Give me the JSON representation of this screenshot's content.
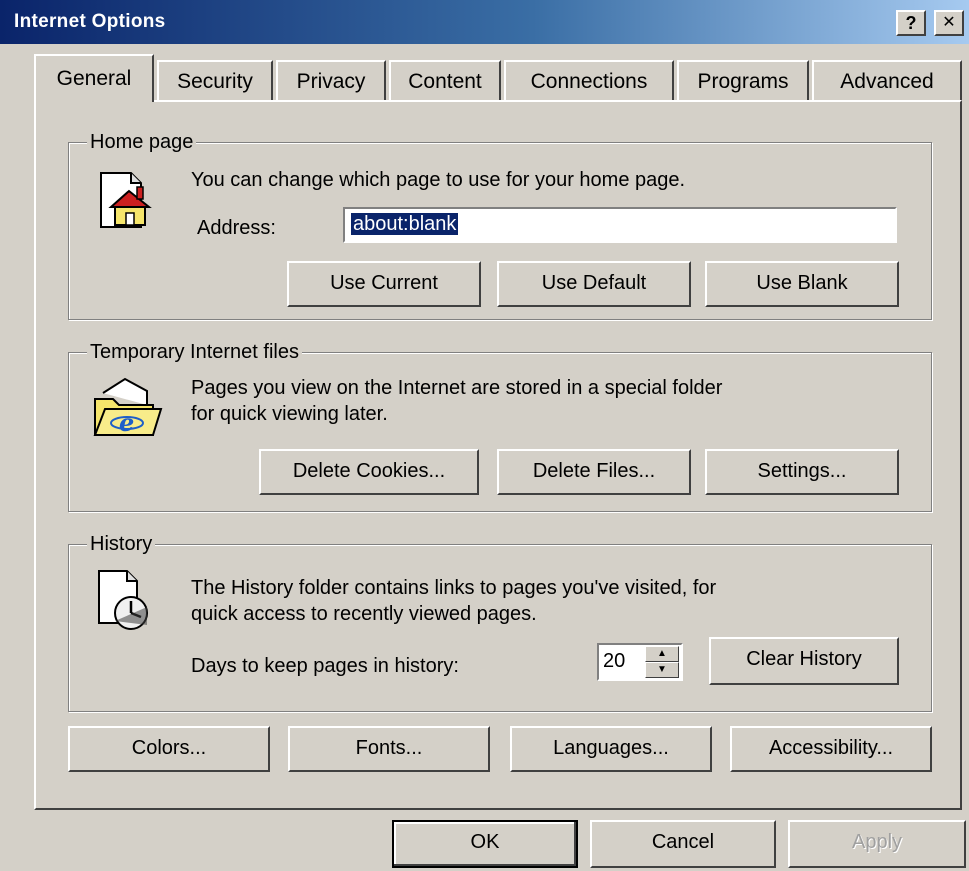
{
  "window": {
    "title": "Internet Options",
    "help_label": "?",
    "close_label": "✕"
  },
  "tabs": [
    {
      "label": "General",
      "active": true
    },
    {
      "label": "Security"
    },
    {
      "label": "Privacy"
    },
    {
      "label": "Content"
    },
    {
      "label": "Connections"
    },
    {
      "label": "Programs"
    },
    {
      "label": "Advanced"
    }
  ],
  "home_page": {
    "legend": "Home page",
    "description": "You can change which page to use for your home page.",
    "address_label": "Address:",
    "address_value": "about:blank",
    "use_current": "Use Current",
    "use_default": "Use Default",
    "use_blank": "Use Blank"
  },
  "temp_files": {
    "legend": "Temporary Internet files",
    "description_line1": "Pages you view on the Internet are stored in a special folder",
    "description_line2": "for quick viewing later.",
    "delete_cookies": "Delete Cookies...",
    "delete_files": "Delete Files...",
    "settings": "Settings..."
  },
  "history": {
    "legend": "History",
    "description_line1": "The History folder contains links to pages you've visited, for",
    "description_line2": "quick access to recently viewed pages.",
    "days_label": "Days to keep pages in history:",
    "days_value": "20",
    "clear_history": "Clear History"
  },
  "bottom_buttons": {
    "colors": "Colors...",
    "fonts": "Fonts...",
    "languages": "Languages...",
    "accessibility": "Accessibility..."
  },
  "dialog_buttons": {
    "ok": "OK",
    "cancel": "Cancel",
    "apply": "Apply"
  },
  "icons": {
    "home": "home-page-icon",
    "temp_files": "temporary-files-folder-icon",
    "history": "history-clock-icon"
  },
  "colors": {
    "titlebar_start": "#0a246a",
    "titlebar_end": "#a6caf0",
    "face": "#d4d0c8",
    "selection": "#0a246a"
  }
}
